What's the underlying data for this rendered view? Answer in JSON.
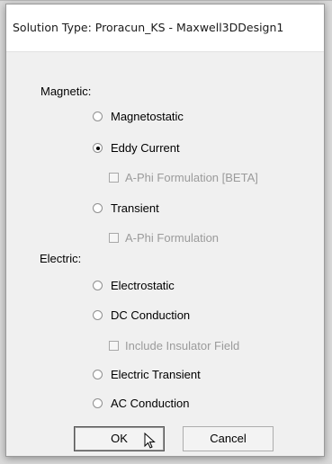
{
  "dialog": {
    "title": "Solution Type: Proracun_KS - Maxwell3DDesign1"
  },
  "magnetic": {
    "label": "Magnetic:",
    "options": [
      {
        "label": "Magnetostatic",
        "selected": false
      },
      {
        "label": "Eddy Current",
        "selected": true
      },
      {
        "label": "A-Phi Formulation [BETA]",
        "kind": "checkbox",
        "checked": false,
        "enabled": false
      },
      {
        "label": "Transient",
        "selected": false
      },
      {
        "label": "A-Phi Formulation",
        "kind": "checkbox",
        "checked": false,
        "enabled": false
      }
    ]
  },
  "electric": {
    "label": "Electric:",
    "options": [
      {
        "label": "Electrostatic",
        "selected": false
      },
      {
        "label": "DC Conduction",
        "selected": false
      },
      {
        "label": "Include Insulator Field",
        "kind": "checkbox",
        "checked": false,
        "enabled": false
      },
      {
        "label": "Electric Transient",
        "selected": false
      },
      {
        "label": "AC Conduction",
        "selected": false
      }
    ]
  },
  "buttons": {
    "ok": "OK",
    "cancel": "Cancel"
  }
}
